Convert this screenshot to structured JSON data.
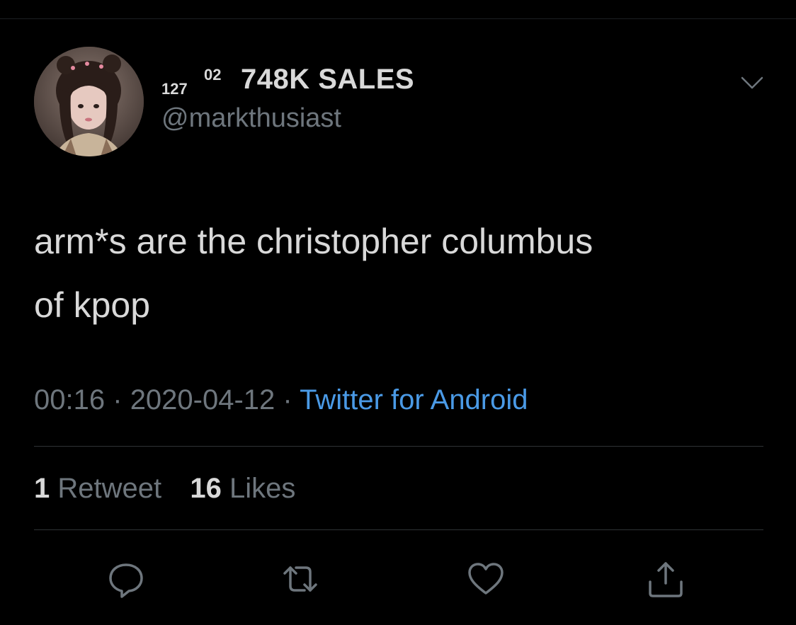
{
  "tweet": {
    "author": {
      "name_part1": "127",
      "name_part2": "02",
      "name_part3": "748K SALES",
      "handle": "@markthusiast"
    },
    "text_line1": "arm*s are the christopher columbus",
    "text_line2": "of kpop",
    "time": "00:16",
    "separator": "·",
    "date": "2020-04-12",
    "source": "Twitter for Android",
    "retweet_count": "1",
    "retweet_label": "Retweet",
    "like_count": "16",
    "like_label": "Likes"
  },
  "icons": {
    "caret": "chevron-down-icon",
    "reply": "reply-icon",
    "retweet": "retweet-icon",
    "like": "heart-icon",
    "share": "share-icon"
  },
  "colors": {
    "background": "#000000",
    "text": "#d9d9d9",
    "muted": "#6e767d",
    "link": "#4a9ae6",
    "divider": "#2f3336"
  }
}
